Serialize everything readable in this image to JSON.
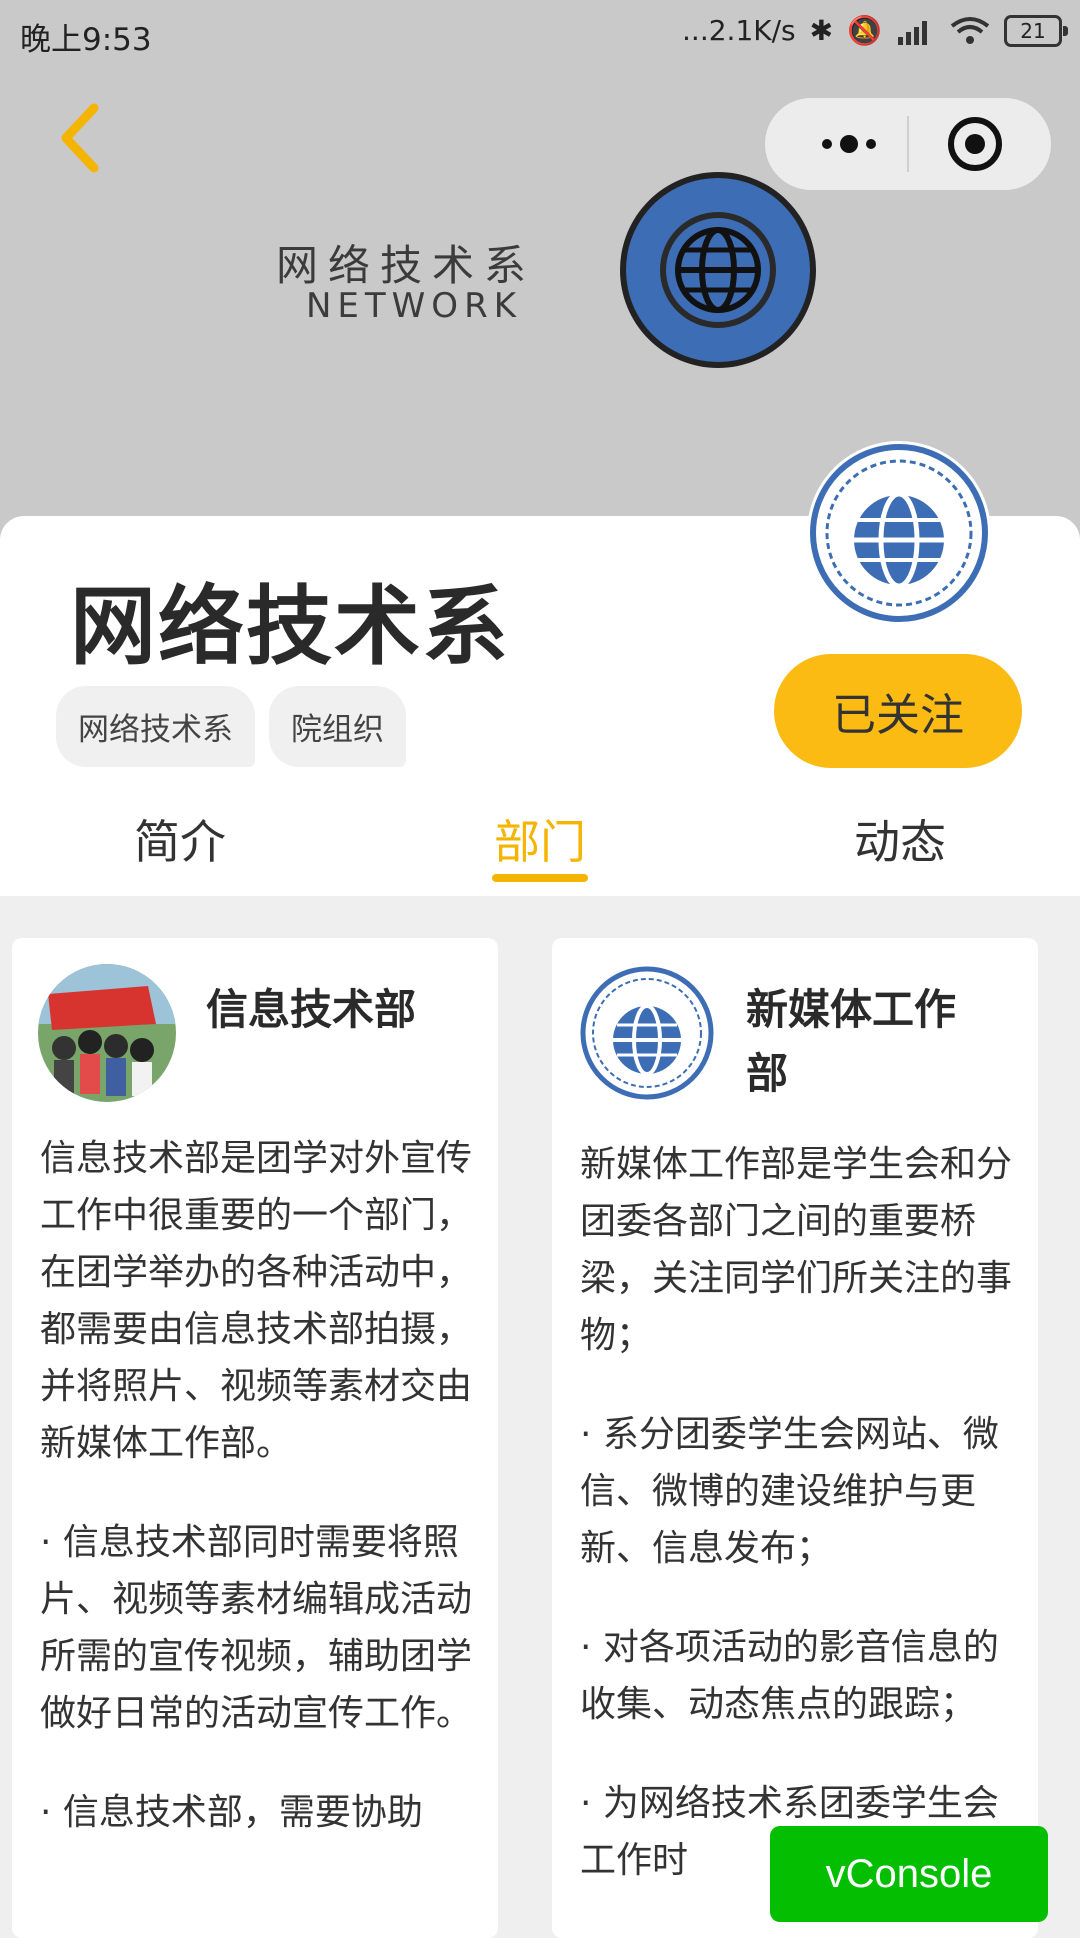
{
  "status_bar": {
    "time": "晚上9:53",
    "network_speed": "...2.1K/s",
    "battery": "21"
  },
  "banner": {
    "text_cn": "网络技术系",
    "text_en": "NETWORK",
    "logo_text": "网络技术系",
    "logo_color": "#3d6db4"
  },
  "header": {
    "title": "网络技术系",
    "tags": [
      "网络技术系",
      "院组织"
    ],
    "follow_label": "已关注",
    "accent_color": "#fbbb12"
  },
  "tabs": [
    {
      "label": "简介",
      "active": false
    },
    {
      "label": "部门",
      "active": true
    },
    {
      "label": "动态",
      "active": false
    }
  ],
  "departments": [
    {
      "name": "信息技术部",
      "avatar": "group-illustration",
      "paragraphs": [
        "信息技术部是团学对外宣传工作中很重要的一个部门，在团学举办的各种活动中，都需要由信息技术部拍摄，并将照片、视频等素材交由新媒体工作部。",
        "· 信息技术部同时需要将照片、视频等素材编辑成活动所需的宣传视频，辅助团学做好日常的活动宣传工作。",
        "· 信息技术部，需要协助"
      ]
    },
    {
      "name": "新媒体工作部",
      "avatar": "network-dept-logo",
      "paragraphs": [
        "新媒体工作部是学生会和分团委各部门之间的重要桥梁，关注同学们所关注的事物；",
        "· 系分团委学生会网站、微信、微博的建设维护与更新、信息发布；",
        "· 对各项活动的影音信息的收集、动态焦点的跟踪；",
        "· 为网络技术系团委学生会工作时"
      ]
    }
  ],
  "vconsole_label": "vConsole"
}
